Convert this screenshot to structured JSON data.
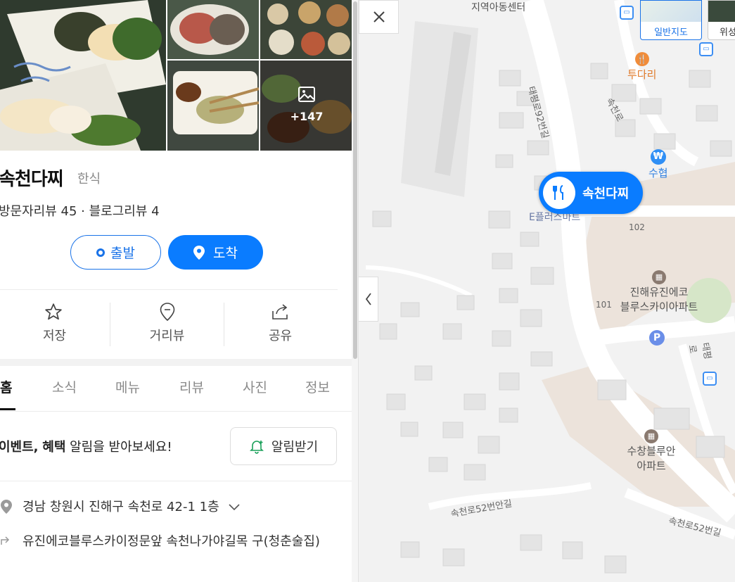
{
  "place": {
    "name": "속천다찌",
    "category": "한식",
    "reviews": "방문자리뷰 45 · 블로그리뷰 4",
    "photo_more": "+147"
  },
  "route": {
    "start": "출발",
    "end": "도착"
  },
  "actions": {
    "save": "저장",
    "streetview": "거리뷰",
    "share": "공유"
  },
  "tabs": [
    "홈",
    "소식",
    "메뉴",
    "리뷰",
    "사진",
    "정보"
  ],
  "promo": {
    "bold1": "이벤트,",
    "bold2": "혜택",
    "rest": " 알림을 받아보세요!",
    "button": "알림받기"
  },
  "info": {
    "address": "경남 창원시 진해구 속천로 42-1 1층",
    "directions": "유진에코블루스카이정문앞 속천나가야길목 구(청춘술집)"
  },
  "map": {
    "pin_label": "속천다찌",
    "map_type_normal": "일반지도",
    "map_type_satellite": "위성",
    "labels": {
      "community_center": "지역아동센터",
      "tudari": "투다리",
      "suhyup": "수협",
      "efl": "E플러스마트",
      "apt_yujin": "진해유진에코",
      "apt_yujin2": "블루스카이아파트",
      "apt_suchang": "수창블루안",
      "apt_suchang2": "아파트",
      "road_92": "태평로92번길",
      "road_52an": "속천로52번안길",
      "road_52": "속천로52번길",
      "road_sok": "속천로",
      "road_tp": "태평로",
      "num_102": "102",
      "num_101": "101"
    },
    "colors": {
      "accent": "#0a7cff",
      "food_poi": "#f08c3a",
      "bank_poi": "#2f8ff5",
      "apt_poi": "#8a7a70",
      "bus_poi": "#3c8ef3"
    }
  }
}
